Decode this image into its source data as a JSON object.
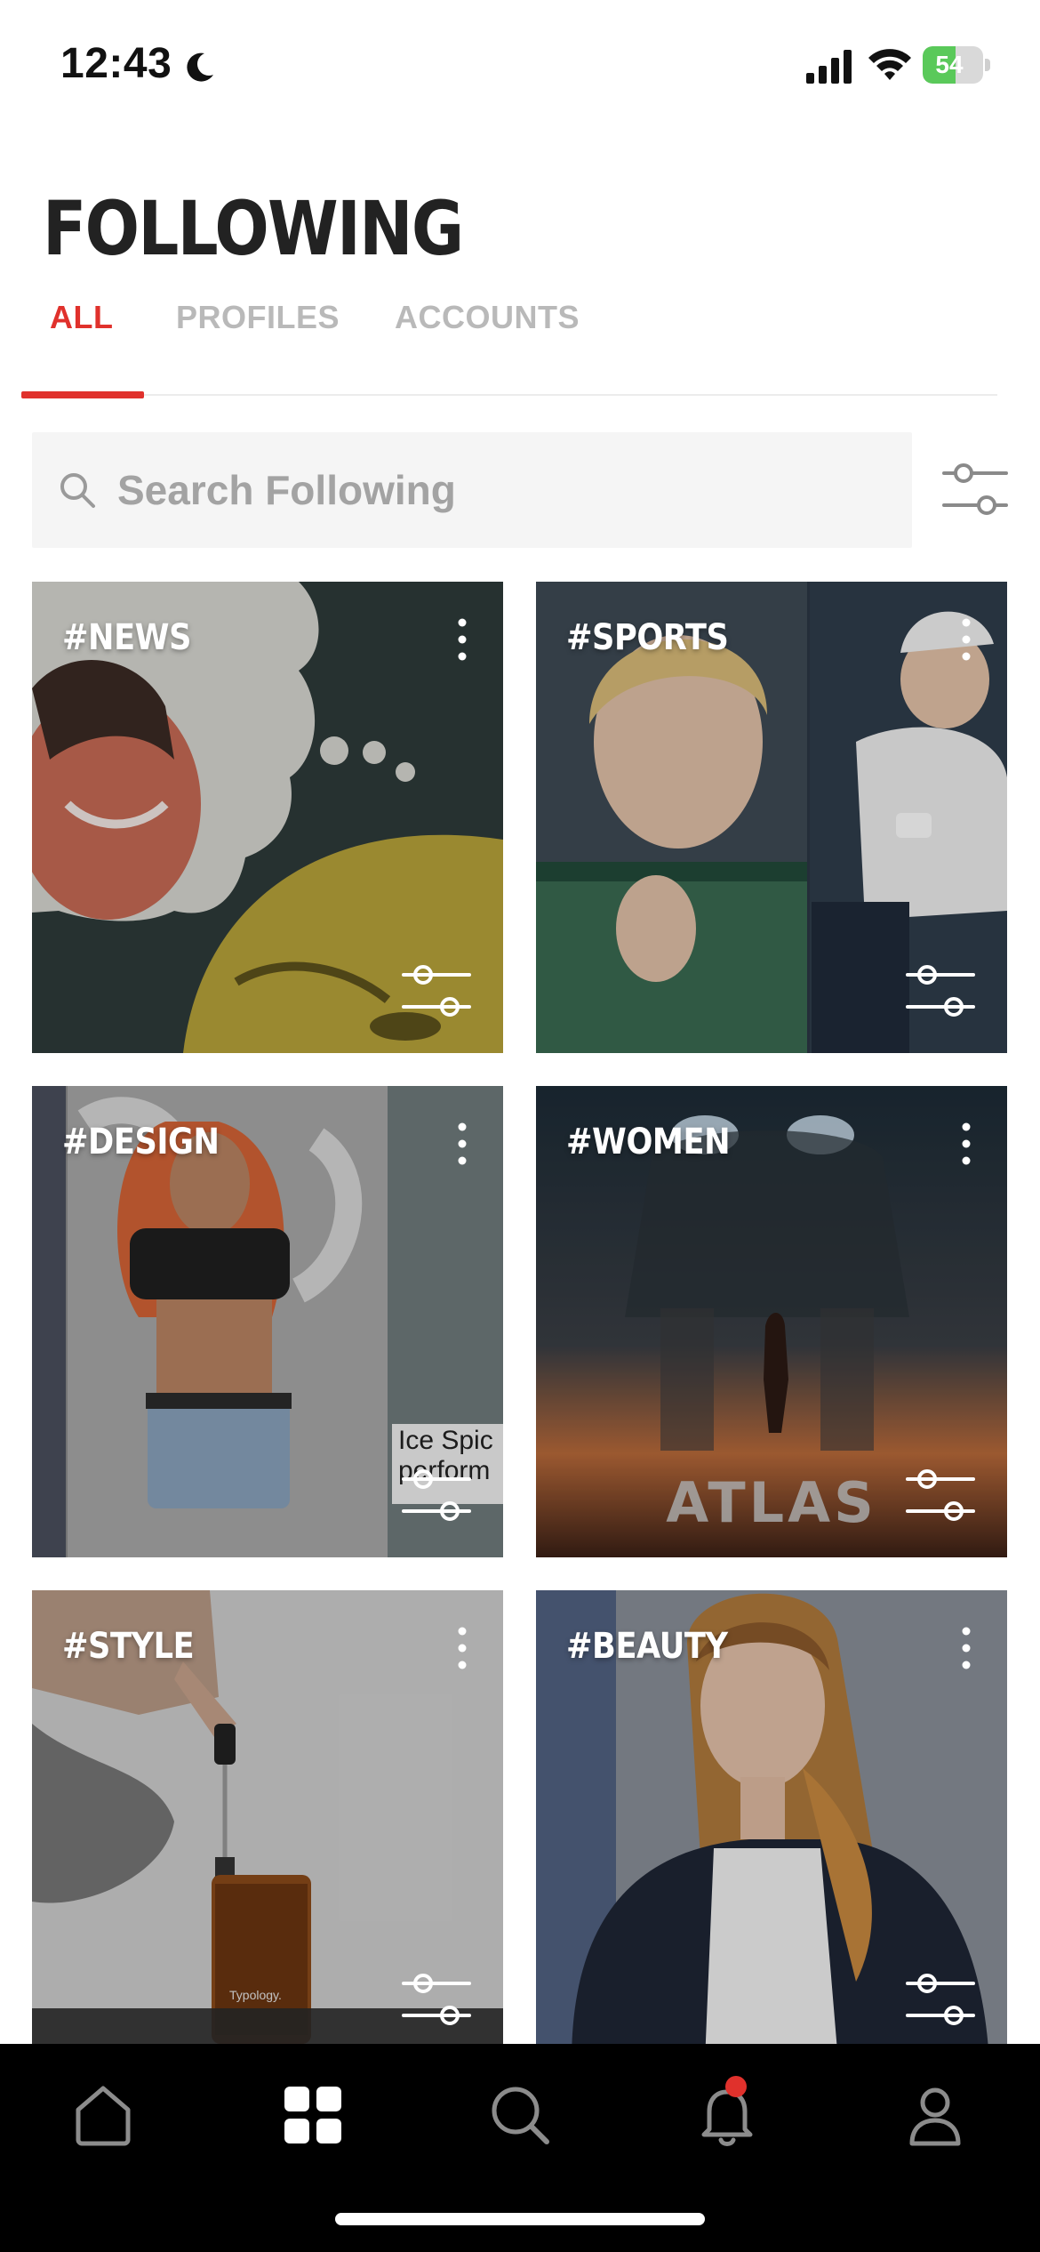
{
  "status_bar": {
    "time": "12:43",
    "battery_percent": "54",
    "battery_level": 0.54,
    "battery_color": "#5ac95a"
  },
  "header": {
    "title": "FOLLOWING"
  },
  "tabs": [
    {
      "label": "ALL",
      "active": true
    },
    {
      "label": "PROFILES",
      "active": false
    },
    {
      "label": "ACCOUNTS",
      "active": false
    }
  ],
  "search": {
    "placeholder": "Search Following",
    "value": ""
  },
  "cards": [
    {
      "label": "#NEWS",
      "menu_icon": "more-vertical-icon",
      "settings_icon": "sliders-icon"
    },
    {
      "label": "#SPORTS",
      "menu_icon": "more-vertical-icon",
      "settings_icon": "sliders-icon"
    },
    {
      "label": "#DESIGN",
      "menu_icon": "more-vertical-icon",
      "settings_icon": "sliders-icon"
    },
    {
      "label": "#WOMEN",
      "menu_icon": "more-vertical-icon",
      "settings_icon": "sliders-icon"
    },
    {
      "label": "#STYLE",
      "menu_icon": "more-vertical-icon",
      "settings_icon": "sliders-icon"
    },
    {
      "label": "#BEAUTY",
      "menu_icon": "more-vertical-icon",
      "settings_icon": "sliders-icon"
    }
  ],
  "bottom_nav": [
    {
      "icon": "home-icon",
      "active": false
    },
    {
      "icon": "grid-icon",
      "active": true
    },
    {
      "icon": "search-icon",
      "active": false
    },
    {
      "icon": "bell-icon",
      "active": false,
      "has_notification": true
    },
    {
      "icon": "profile-icon",
      "active": false
    }
  ],
  "colors": {
    "accent": "#e0312c",
    "inactive_tab": "#b9b9b9",
    "nav_background": "#000000"
  }
}
